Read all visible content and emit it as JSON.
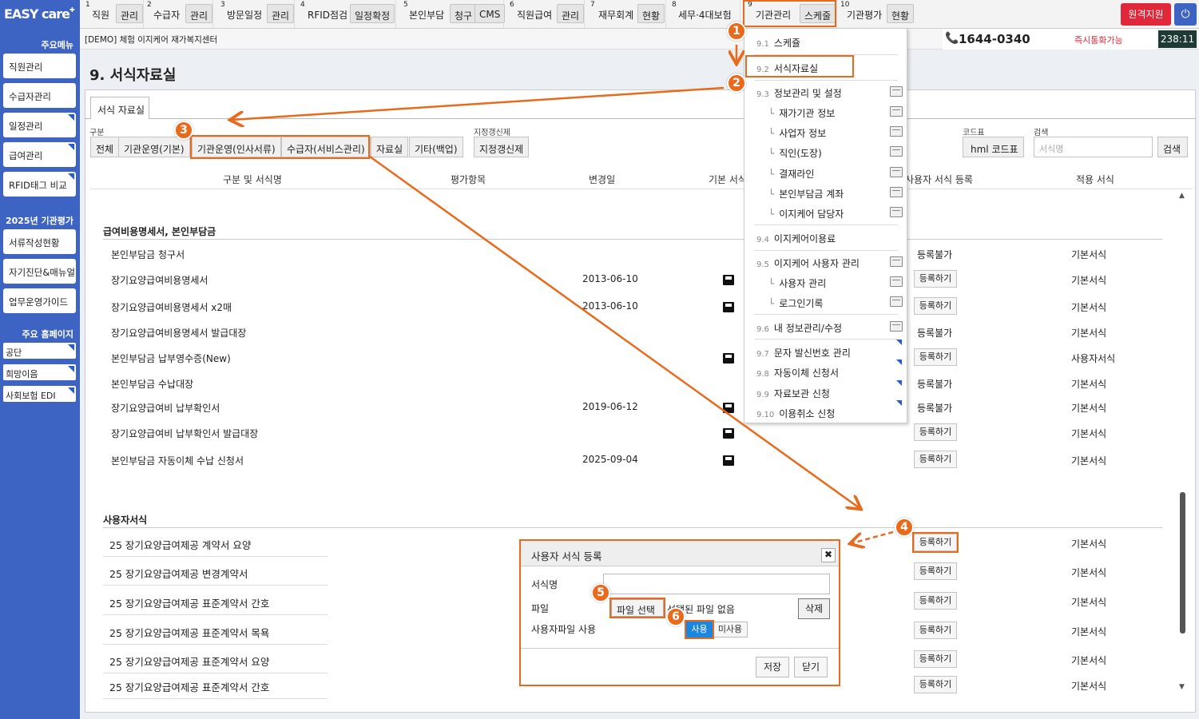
{
  "app": {
    "logo": "EASY care",
    "remote_support": "원격지원",
    "center_name": "[DEMO] 체험 이지케어 재가복지센터",
    "phone": "1644-0340",
    "call_now": "즉시통화가능",
    "clock": "238:11"
  },
  "sidebar": {
    "main_menu_header": "주요메뉴",
    "main_items": [
      "직원관리",
      "수급자관리",
      "일정관리",
      "급여관리",
      "RFID태그 비교"
    ],
    "eval_header": "2025년 기관평가",
    "eval_items": [
      "서류작성현황",
      "자기진단&매뉴얼",
      "업무운영가이드"
    ],
    "home_header": "주요 홈페이지",
    "home_links": [
      "공단",
      "희망이음",
      "사회보험 EDI"
    ]
  },
  "topnav": [
    {
      "num": "1",
      "label": "직원",
      "btn": "관리"
    },
    {
      "num": "2",
      "label": "수급자",
      "btn": "관리"
    },
    {
      "num": "3",
      "label": "방문일정",
      "btn": "관리"
    },
    {
      "num": "4",
      "label": "RFID점검",
      "btn": "일정확정"
    },
    {
      "num": "5",
      "label": "본인부담",
      "btn": "청구",
      "btn2": "CMS"
    },
    {
      "num": "6",
      "label": "직원급여",
      "btn": "관리"
    },
    {
      "num": "7",
      "label": "재무회계",
      "btn": "현황"
    },
    {
      "num": "8",
      "label": "세무·4대보험",
      "btn": ""
    },
    {
      "num": "9",
      "label": "기관관리",
      "btn": "스케줄"
    },
    {
      "num": "10",
      "label": "기관평가",
      "btn": "현황"
    }
  ],
  "page": {
    "title": "9. 서식자료실",
    "tab": "서식 자료실"
  },
  "filters": {
    "category_label": "구분",
    "category_buttons": [
      "전체",
      "기관운영(기본)",
      "기관운영(인사서류)",
      "수급자(서비스관리)",
      "자료실",
      "기타(백업)"
    ],
    "designated_label": "지정갱신제",
    "designated_button": "지정갱신제",
    "code_label": "코드표",
    "code_button": "hml 코드표",
    "search_label": "검색",
    "search_placeholder": "서식명",
    "search_button": "검색"
  },
  "table": {
    "headers": [
      "구분 및 서식명",
      "평가항목",
      "변경일",
      "기본 서식",
      "사용자 서식 등록",
      "적용 서식"
    ],
    "section1_title": "급여비용명세서, 본인부담금",
    "section1_rows": [
      {
        "name": "본인부담금 청구서",
        "date": "",
        "save": false,
        "reg": "등록불가",
        "reg_btn": false,
        "apply": "기본서식"
      },
      {
        "name": "장기요양급여비용명세서",
        "date": "2013-06-10",
        "save": true,
        "reg": "등록하기",
        "reg_btn": true,
        "apply": "기본서식"
      },
      {
        "name": "장기요양급여비용명세서 x2매",
        "date": "2013-06-10",
        "save": true,
        "reg": "등록하기",
        "reg_btn": true,
        "apply": "기본서식"
      },
      {
        "name": "장기요양급여비용명세서 발급대장",
        "date": "",
        "save": false,
        "reg": "등록불가",
        "reg_btn": false,
        "apply": "기본서식"
      },
      {
        "name": "본인부담금 납부영수증(New)",
        "date": "",
        "save": true,
        "reg": "등록하기",
        "reg_btn": true,
        "apply": "사용자서식"
      },
      {
        "name": "본인부담금 수납대장",
        "date": "",
        "save": false,
        "reg": "등록불가",
        "reg_btn": false,
        "apply": "기본서식"
      },
      {
        "name": "장기요양급여비 납부확인서",
        "date": "2019-06-12",
        "save": true,
        "reg": "등록불가",
        "reg_btn": false,
        "apply": "기본서식"
      },
      {
        "name": "장기요양급여비 납부확인서 발급대장",
        "date": "",
        "save": true,
        "reg": "등록하기",
        "reg_btn": true,
        "apply": "기본서식"
      },
      {
        "name": "본인부담금 자동이체 수납 신청서",
        "date": "2025-09-04",
        "save": true,
        "reg": "등록하기",
        "reg_btn": true,
        "apply": "기본서식"
      }
    ],
    "section2_title": "사용자서식",
    "section2_rows": [
      {
        "name": "25 장기요양급여제공 계약서 요양",
        "reg": "등록하기",
        "apply": "기본서식"
      },
      {
        "name": "25 장기요양급여제공 변경계약서",
        "reg": "등록하기",
        "apply": "기본서식"
      },
      {
        "name": "25 장기요양급여제공 표준계약서 간호",
        "reg": "등록하기",
        "apply": "기본서식"
      },
      {
        "name": "25 장기요양급여제공 표준계약서 목욕",
        "reg": "등록하기",
        "apply": "기본서식"
      },
      {
        "name": "25 장기요양급여제공 표준계약서 요양",
        "reg": "등록하기",
        "apply": "기본서식"
      },
      {
        "name": "25 장기요양급여제공 표준계약서 간호",
        "reg": "등록하기",
        "apply": "기본서식"
      }
    ]
  },
  "dropdown": {
    "items": [
      {
        "num": "9.1",
        "label": "스케쥴"
      },
      {
        "num": "9.2",
        "label": "서식자료실"
      },
      {
        "num": "9.3",
        "label": "정보관리 및 설정"
      },
      {
        "num": "9.4",
        "label": "이지케어이용료"
      },
      {
        "num": "9.5",
        "label": "이지케어 사용자 관리"
      },
      {
        "num": "9.6",
        "label": "내 정보관리/수정"
      },
      {
        "num": "9.7",
        "label": "문자 발신번호 관리"
      },
      {
        "num": "9.8",
        "label": "자동이체 신청서"
      },
      {
        "num": "9.9",
        "label": "자료보관 신청"
      },
      {
        "num": "9.10",
        "label": "이용취소 신청"
      }
    ],
    "sub_93": [
      "재가기관 정보",
      "사업자 정보",
      "직인(도장)",
      "결재라인",
      "본인부담금 계좌",
      "이지케어 담당자"
    ],
    "sub_95": [
      "사용자 관리",
      "로그인기록"
    ]
  },
  "modal": {
    "title": "사용자 서식 등록",
    "name_label": "서식명",
    "file_label": "파일",
    "file_button": "파일 선택",
    "no_file": "선택된 파일 없음",
    "delete": "삭제",
    "use_label": "사용자파일 사용",
    "use": "사용",
    "no_use": "미사용",
    "save": "저장",
    "close": "닫기"
  },
  "steps": [
    "1",
    "2",
    "3",
    "4",
    "5",
    "6"
  ],
  "colors": {
    "sidebar": "#3d64c2",
    "accent": "#e86a1c",
    "remote": "#e0283a",
    "use_toggle": "#1a86e0"
  }
}
